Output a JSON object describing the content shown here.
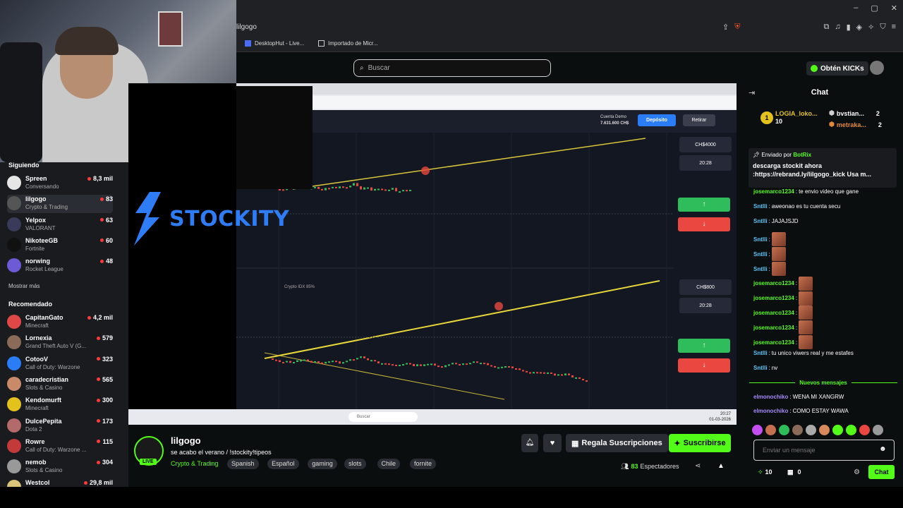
{
  "browser": {
    "url_text": "lilgogo",
    "bookmarks": [
      {
        "label": "DesktopHut - Live..."
      },
      {
        "label": "Importado de Micr..."
      }
    ],
    "window_controls": [
      "–",
      "▢",
      "✕"
    ]
  },
  "header": {
    "search_placeholder": "Buscar",
    "get_kicks_label": "Obtén KICKs"
  },
  "sidebar": {
    "following_title": "Siguiendo",
    "following": [
      {
        "name": "Spreen",
        "category": "Conversando",
        "viewers": "8,3 mil",
        "color": "#e6e6e6"
      },
      {
        "name": "lilgogo",
        "category": "Crypto & Trading",
        "viewers": "83",
        "color": "#555555",
        "active": true
      },
      {
        "name": "Yelpox",
        "category": "VALORANT",
        "viewers": "63",
        "color": "#3a3a5a"
      },
      {
        "name": "NikoteeGB",
        "category": "Fortnite",
        "viewers": "60",
        "color": "#111111"
      },
      {
        "name": "norwing",
        "category": "Rocket League",
        "viewers": "48",
        "color": "#6b5bd6"
      }
    ],
    "show_more": "Mostrar más",
    "recommended_title": "Recomendado",
    "recommended": [
      {
        "name": "CapitanGato",
        "category": "Minecraft",
        "viewers": "4,2 mil",
        "color": "#e04848"
      },
      {
        "name": "Lornexia",
        "category": "Grand Theft Auto V (G...",
        "viewers": "579",
        "color": "#8a6a58"
      },
      {
        "name": "CotooV",
        "category": "Call of Duty: Warzone",
        "viewers": "323",
        "color": "#2a7cf7"
      },
      {
        "name": "caradecristian",
        "category": "Slots & Casino",
        "viewers": "565",
        "color": "#c98a6a"
      },
      {
        "name": "Kendomurft",
        "category": "Minecraft",
        "viewers": "300",
        "color": "#e3c21b"
      },
      {
        "name": "DulcePepita",
        "category": "Dota 2",
        "viewers": "173",
        "color": "#b36a6a"
      },
      {
        "name": "Rowre",
        "category": "Call of Duty: Warzone ...",
        "viewers": "115",
        "color": "#c43a3a"
      },
      {
        "name": "nemob",
        "category": "Slots & Casino",
        "viewers": "304",
        "color": "#999999"
      },
      {
        "name": "Westcol",
        "category": "",
        "viewers": "29,8 mil",
        "color": "#d9c47a"
      }
    ]
  },
  "video": {
    "stockity_text": "STOCKITY",
    "screen": {
      "balance_label": "Cuenta Demo",
      "balance_value": "7.631.600 CH$",
      "deposit_label": "Depósito",
      "withdraw_label": "Retirar",
      "amount_top": "CH$4000",
      "time_top": "20:28",
      "amount_bottom": "CH$800",
      "time_bottom": "20:28",
      "asset_label": "Crypto IDX 85%",
      "search_label": "Buscar",
      "clock_time": "20:27",
      "clock_date": "01-03-2026"
    }
  },
  "channel": {
    "name": "lilgogo",
    "live_label": "LIVE",
    "title": "se acabo el verano / !stockity!tipeos",
    "category": "Crypto & Trading",
    "tags": [
      "Spanish",
      "Español",
      "gaming",
      "slots",
      "Chile",
      "fornite"
    ],
    "gift_label": "Regala Suscripciones",
    "subscribe_label": "Suscribirse",
    "viewers_count": "83",
    "viewers_label": "Espectadores"
  },
  "chat": {
    "title": "Chat",
    "leaderboard": [
      {
        "rank": "1",
        "name": "LOGIA_loko...",
        "amount": "10",
        "color": "#e3c21b"
      },
      {
        "name": "bvstian...",
        "amount": "2",
        "color": "#cfcfcf"
      },
      {
        "name": "metraka...",
        "amount": "2",
        "color": "#e08a3a"
      }
    ],
    "pinned": {
      "sent_by_label": "Enviado por",
      "sent_by_user": "BotRix",
      "line1": "descarga stockit ahora",
      "line2": ":https://rebrand.ly/lilgogo_kick Usa m..."
    },
    "messages": [
      {
        "user": "josemarco1234",
        "color": "#53fc18",
        "text": "te envio video que gane"
      },
      {
        "user": "Sntlli",
        "color": "#53c8fc",
        "text": "aweonao es tu cuenta secu"
      },
      {
        "user": "Sntlli",
        "color": "#53c8fc",
        "text": "JAJAJSJD"
      },
      {
        "user": "Sntlli",
        "color": "#53c8fc",
        "text": "",
        "emote": true
      },
      {
        "user": "Sntlli",
        "color": "#53c8fc",
        "text": "",
        "emote": true
      },
      {
        "user": "Sntlli",
        "color": "#53c8fc",
        "text": "",
        "emote": true
      },
      {
        "user": "josemarco1234",
        "color": "#53fc18",
        "text": "",
        "emote": true
      },
      {
        "user": "josemarco1234",
        "color": "#53fc18",
        "text": "",
        "emote": true
      },
      {
        "user": "josemarco1234",
        "color": "#53fc18",
        "text": "",
        "emote": true
      },
      {
        "user": "josemarco1234",
        "color": "#53fc18",
        "text": "",
        "emote": true
      },
      {
        "user": "josemarco1234",
        "color": "#53fc18",
        "text": "",
        "emote": true
      },
      {
        "user": "Sntlli",
        "color": "#53c8fc",
        "text": "tu unico viwers real y me estafes"
      },
      {
        "user": "Sntlli",
        "color": "#53c8fc",
        "text": "nv"
      }
    ],
    "new_messages_label": "Nuevos mensajes",
    "new_messages": [
      {
        "user": "elmonochiko",
        "color": "#a78bfa",
        "text": "WENA MI XANGRW"
      },
      {
        "user": "elmonochiko",
        "color": "#a78bfa",
        "text": "COMO ESTAY WAWA"
      }
    ],
    "input_placeholder": "Enviar un mensaje",
    "kicks_count": "10",
    "gifts_count": "0",
    "send_label": "Chat"
  }
}
